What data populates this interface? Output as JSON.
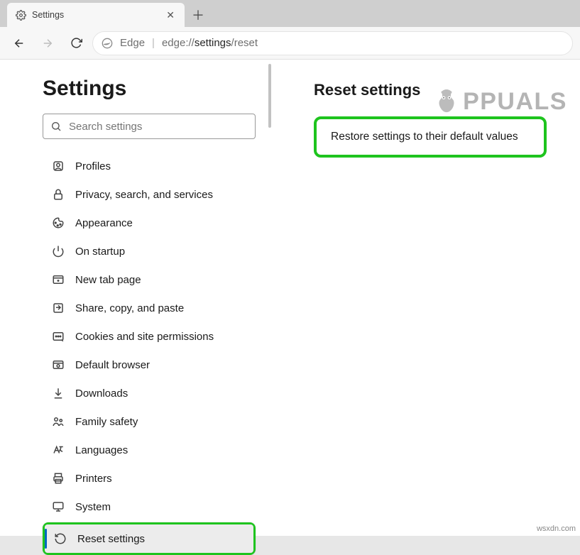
{
  "tab": {
    "title": "Settings"
  },
  "address_bar": {
    "brand": "Edge",
    "url_prefix": "edge://",
    "url_mid": "settings",
    "url_suffix": "/reset"
  },
  "sidebar": {
    "heading": "Settings",
    "search_placeholder": "Search settings",
    "items": [
      {
        "label": "Profiles"
      },
      {
        "label": "Privacy, search, and services"
      },
      {
        "label": "Appearance"
      },
      {
        "label": "On startup"
      },
      {
        "label": "New tab page"
      },
      {
        "label": "Share, copy, and paste"
      },
      {
        "label": "Cookies and site permissions"
      },
      {
        "label": "Default browser"
      },
      {
        "label": "Downloads"
      },
      {
        "label": "Family safety"
      },
      {
        "label": "Languages"
      },
      {
        "label": "Printers"
      },
      {
        "label": "System"
      },
      {
        "label": "Reset settings"
      }
    ]
  },
  "main": {
    "heading": "Reset settings",
    "restore_label": "Restore settings to their default values"
  },
  "watermark": "PPUALS",
  "source": "wsxdn.com"
}
